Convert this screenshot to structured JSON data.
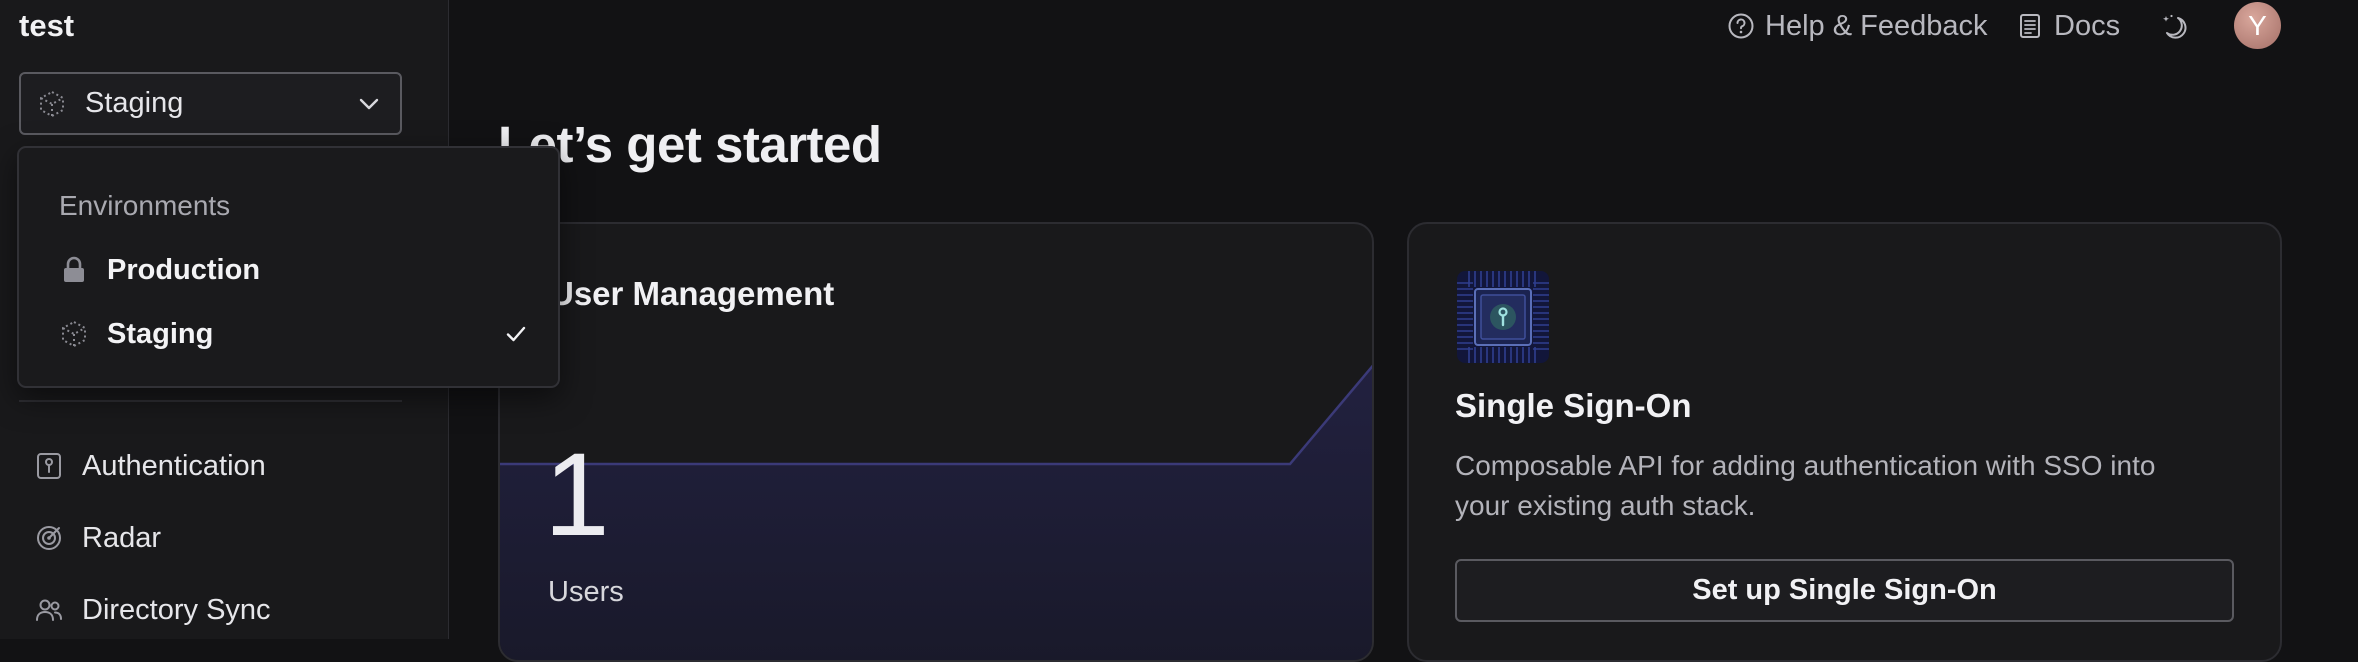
{
  "app": {
    "title": "test"
  },
  "environment_select": {
    "selected": "Staging",
    "icon": "cube-icon"
  },
  "dropdown": {
    "section_label": "Environments",
    "options": [
      {
        "label": "Production",
        "icon": "lock-icon",
        "selected": false
      },
      {
        "label": "Staging",
        "icon": "cube-icon",
        "selected": true
      }
    ]
  },
  "sidebar": {
    "items": [
      {
        "label": "Authentication",
        "icon": "keyhole-icon"
      },
      {
        "label": "Radar",
        "icon": "radar-icon"
      },
      {
        "label": "Directory Sync",
        "icon": "users-icon"
      }
    ]
  },
  "topbar": {
    "help_label": "Help & Feedback",
    "docs_label": "Docs",
    "theme_icon": "moon-stars-icon",
    "avatar_initial": "Y"
  },
  "main": {
    "title": "Let’s get started",
    "user_management": {
      "title": "User Management",
      "count": "1",
      "count_label": "Users"
    },
    "sso": {
      "title": "Single Sign-On",
      "description": "Composable API for adding authentication with SSO into your existing auth stack.",
      "button_label": "Set up Single Sign-On"
    }
  },
  "colors": {
    "background": "#121214",
    "sidebar": "#19191b",
    "card": "#19191b",
    "chart_line": "#3b3a78",
    "chart_fill": "#1f1e36"
  }
}
